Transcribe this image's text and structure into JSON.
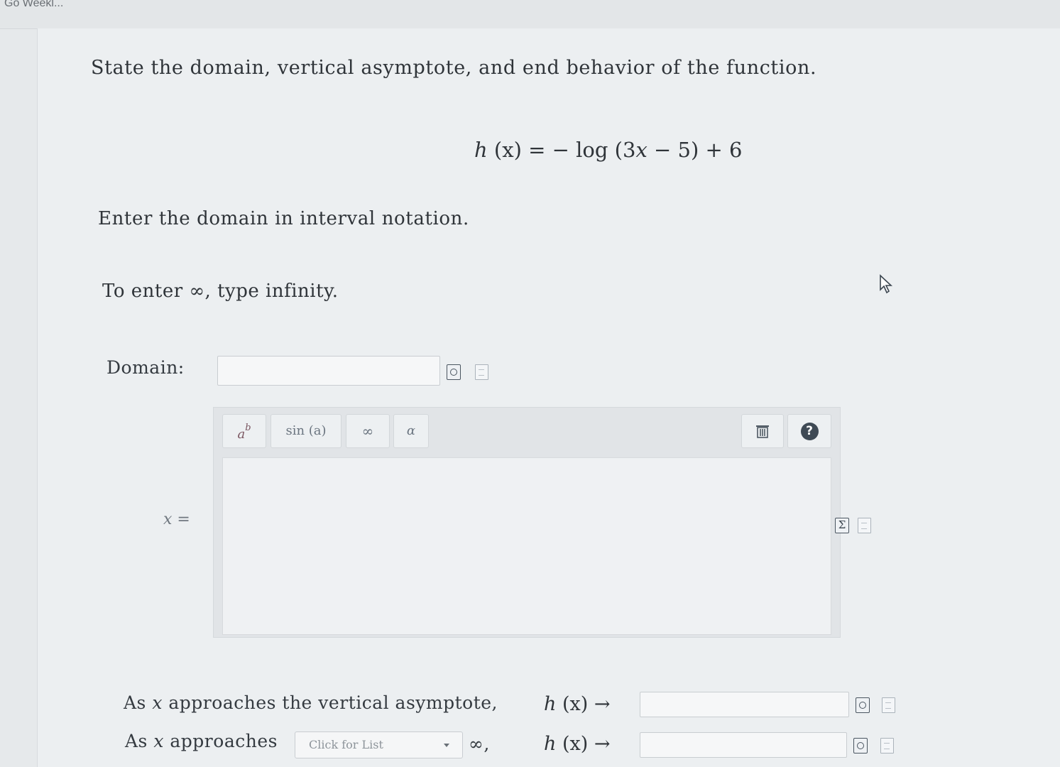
{
  "topbar": {
    "title": "Go Weekl..."
  },
  "question": {
    "prompt": "State the domain, vertical asymptote, and end behavior of the function.",
    "formula": {
      "lhs_fn": "h",
      "lhs_arg": "(x)",
      "eq": " = − log (3",
      "var": "x",
      "rest": " − 5) + 6"
    },
    "instruction_domain": "Enter the domain in interval notation.",
    "instruction_infinity": "To enter ∞, type infinity."
  },
  "domain": {
    "label": "Domain:",
    "value": ""
  },
  "editor": {
    "toolbar": {
      "power_base": "a",
      "power_exp": "b",
      "trig": "sin (a)",
      "infinity": "∞",
      "alpha": "α",
      "trash": "🗑",
      "help": "?"
    },
    "var_label": "x",
    "eq_sign": "="
  },
  "asymptote_row": {
    "text_pre": "As ",
    "var": "x",
    "text_post": " approaches the vertical asymptote,",
    "hx_fn": "h",
    "hx_arg": "(x)",
    "arrow": " →",
    "value": ""
  },
  "end_row": {
    "text_pre": "As ",
    "var": "x",
    "text_post": " approaches",
    "select_value": "Click for List",
    "after_select": "∞,",
    "hx_fn": "h",
    "hx_arg": "(x)",
    "arrow": " →",
    "value": ""
  },
  "icons": {
    "preview": "preview-icon",
    "document": "document-icon",
    "sigma": "sigma-icon",
    "cursor": "mouse-cursor-icon"
  }
}
